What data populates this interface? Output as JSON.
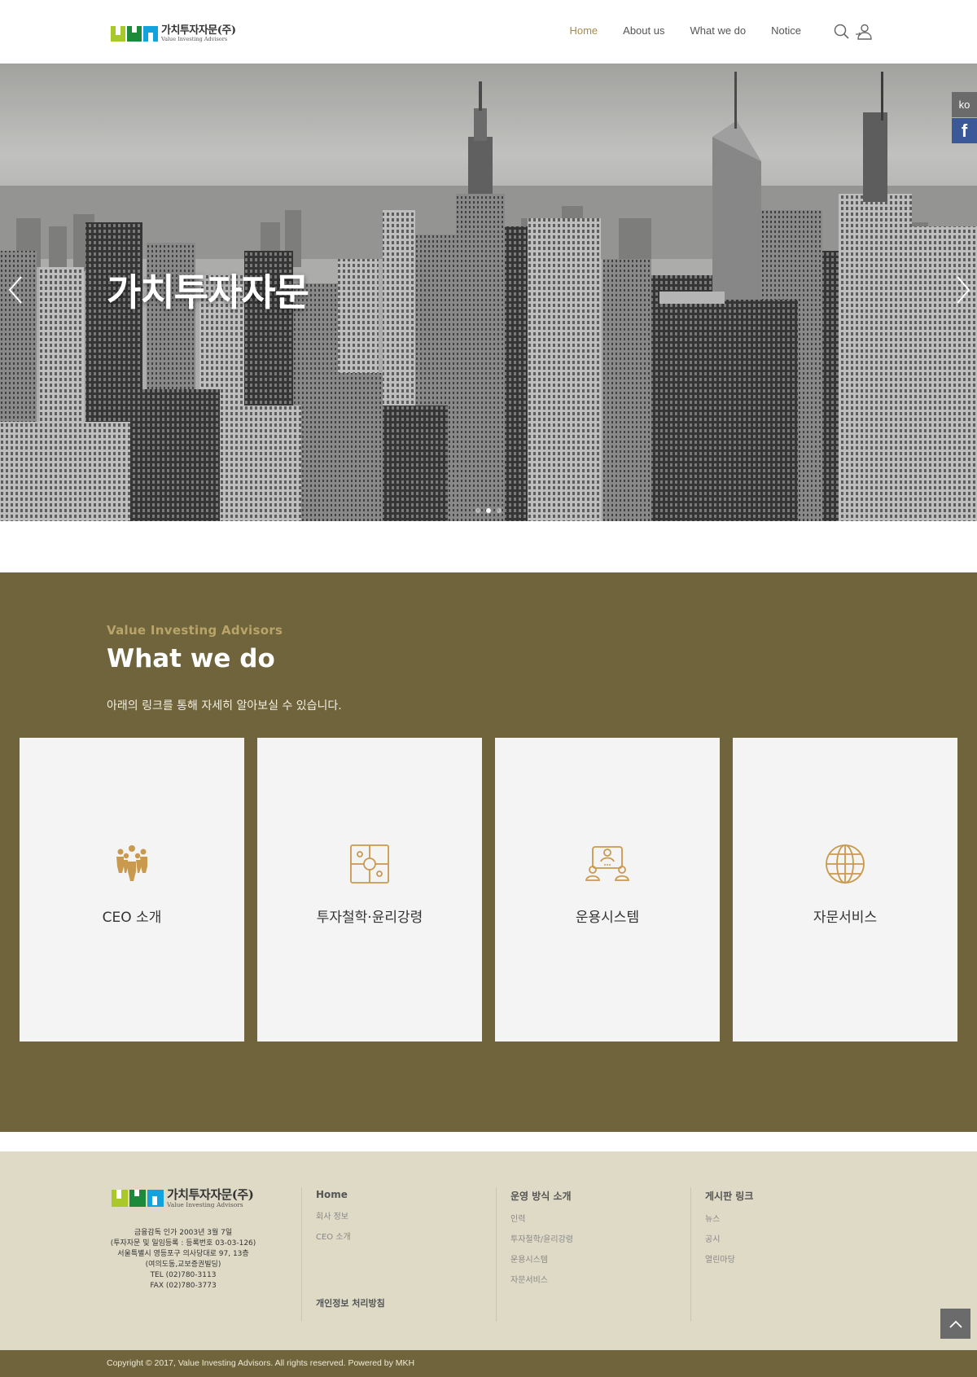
{
  "header": {
    "logo_ko": "가치투자자문(주)",
    "logo_en": "Value Investing Advisors",
    "nav": [
      {
        "label": "Home",
        "active": true
      },
      {
        "label": "About us",
        "active": false
      },
      {
        "label": "What we do",
        "active": false
      },
      {
        "label": "Notice",
        "active": false
      }
    ],
    "icons": [
      "search-icon",
      "user-login-icon"
    ],
    "accent_color": "#a88b4a"
  },
  "side": {
    "language": "ko",
    "facebook_glyph": "f"
  },
  "hero": {
    "title": "가치투자자문",
    "slide_count": 3,
    "active_slide": 2
  },
  "what_we_do": {
    "kicker": "Value Investing Advisors",
    "title": "What we do",
    "description": "아래의 링크를 통해 자세히 알아보실 수 있습니다.",
    "background_color": "#6f643b",
    "cards": [
      {
        "label": "CEO 소개",
        "icon": "people-group-icon"
      },
      {
        "label": "투자철학·윤리강령",
        "icon": "puzzle-icon"
      },
      {
        "label": "운용시스템",
        "icon": "meeting-icon"
      },
      {
        "label": "자문서비스",
        "icon": "globe-icon"
      }
    ]
  },
  "footer": {
    "logo_ko": "가치투자자문(주)",
    "logo_en": "Value Investing Advisors",
    "info_lines": [
      "금융감독 인가 2003년 3월 7일",
      "(투자자문 및 일임등록 : 등록번호 03-03-126)",
      "서울특별시 영등포구 의사당대로 97, 13층",
      "(여의도동,교보증권빌딩)",
      "TEL (02)780-3113",
      "FAX (02)780-3773"
    ],
    "columns": [
      {
        "heading": "Home",
        "links": [
          "회사 정보",
          "CEO 소개"
        ]
      },
      {
        "heading": "운영 방식 소개",
        "links": [
          "인력",
          "투자철학/윤리강령",
          "운용시스템",
          "자문서비스"
        ]
      },
      {
        "heading": "게시판 링크",
        "links": [
          "뉴스",
          "공시",
          "열린마당"
        ]
      }
    ],
    "privacy": "개인정보 처리방침",
    "copyright": "Copyright © 2017, Value Investing Advisors. All rights reserved. Powered by MKH"
  }
}
